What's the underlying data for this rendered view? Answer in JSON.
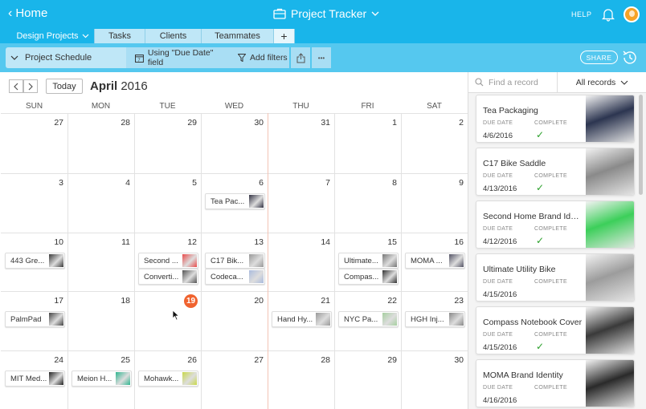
{
  "header": {
    "home_label": "Home",
    "base_title": "Project Tracker",
    "help_label": "HELP"
  },
  "tables": [
    {
      "label": "Design Projects",
      "active": true
    },
    {
      "label": "Tasks",
      "active": false
    },
    {
      "label": "Clients",
      "active": false
    },
    {
      "label": "Teammates",
      "active": false
    }
  ],
  "add_table_label": "+",
  "viewbar": {
    "view_name": "Project Schedule",
    "date_field_label": "Using \"Due Date\" field",
    "filter_label": "Add filters",
    "more_label": "•••",
    "share_label": "SHARE"
  },
  "calendar": {
    "today_label": "Today",
    "month": "April",
    "year": "2016",
    "weekdays": [
      "SUN",
      "MON",
      "TUE",
      "WED",
      "THU",
      "FRI",
      "SAT"
    ],
    "weeks": [
      [
        "27",
        "28",
        "29",
        "30",
        "31",
        "1",
        "2"
      ],
      [
        "3",
        "4",
        "5",
        "6",
        "7",
        "8",
        "9"
      ],
      [
        "10",
        "11",
        "12",
        "13",
        "14",
        "15",
        "16"
      ],
      [
        "17",
        "18",
        "19",
        "20",
        "21",
        "22",
        "23"
      ],
      [
        "24",
        "25",
        "26",
        "27",
        "28",
        "29",
        "30"
      ]
    ],
    "today": "19",
    "events": [
      {
        "label": "Tea Pac...",
        "week": 1,
        "day": 3,
        "slot": 0,
        "color": "#333344"
      },
      {
        "label": "443 Gre...",
        "week": 2,
        "day": 0,
        "slot": 0,
        "color": "#3b3b3b"
      },
      {
        "label": "Second ...",
        "week": 2,
        "day": 2,
        "slot": 0,
        "color": "#e84c4c"
      },
      {
        "label": "Converti...",
        "week": 2,
        "day": 2,
        "slot": 1,
        "color": "#555555"
      },
      {
        "label": "C17 Bik...",
        "week": 2,
        "day": 3,
        "slot": 0,
        "color": "#999999"
      },
      {
        "label": "Codeca...",
        "week": 2,
        "day": 3,
        "slot": 1,
        "color": "#aabbdd"
      },
      {
        "label": "Ultimate...",
        "week": 2,
        "day": 5,
        "slot": 0,
        "color": "#777777"
      },
      {
        "label": "Compas...",
        "week": 2,
        "day": 5,
        "slot": 1,
        "color": "#333333"
      },
      {
        "label": "MOMA ...",
        "week": 2,
        "day": 6,
        "slot": 0,
        "color": "#555566"
      },
      {
        "label": "PalmPad",
        "week": 3,
        "day": 0,
        "slot": 0,
        "color": "#444444"
      },
      {
        "label": "Hand Hy...",
        "week": 3,
        "day": 4,
        "slot": 0,
        "color": "#999999"
      },
      {
        "label": "NYC Pa...",
        "week": 3,
        "day": 5,
        "slot": 0,
        "color": "#a6cfa0"
      },
      {
        "label": "HGH Inj...",
        "week": 3,
        "day": 6,
        "slot": 0,
        "color": "#888888"
      },
      {
        "label": "MIT Med...",
        "week": 4,
        "day": 0,
        "slot": 0,
        "color": "#222222"
      },
      {
        "label": "Meion H...",
        "week": 4,
        "day": 1,
        "slot": 0,
        "color": "#2fb58f"
      },
      {
        "label": "Mohawk...",
        "week": 4,
        "day": 2,
        "slot": 0,
        "color": "#c8d84a"
      }
    ]
  },
  "records_panel": {
    "search_placeholder": "Find a record",
    "filter_label": "All records",
    "due_date_label": "DUE DATE",
    "complete_label": "COMPLETE",
    "check_glyph": "✓",
    "records": [
      {
        "title": "Tea Packaging",
        "due_date": "4/6/2016",
        "complete": true,
        "color": "#2c3550"
      },
      {
        "title": "C17 Bike Saddle",
        "due_date": "4/13/2016",
        "complete": true,
        "color": "#8a8a8a"
      },
      {
        "title": "Second Home Brand Identity",
        "due_date": "4/12/2016",
        "complete": true,
        "color": "#3ccf5a"
      },
      {
        "title": "Ultimate Utility Bike",
        "due_date": "4/15/2016",
        "complete": false,
        "color": "#9c9c9c"
      },
      {
        "title": "Compass Notebook Cover",
        "due_date": "4/15/2016",
        "complete": true,
        "color": "#3a3a3a"
      },
      {
        "title": "MOMA Brand Identity",
        "due_date": "4/16/2016",
        "complete": false,
        "color": "#2a2a2a"
      }
    ]
  }
}
